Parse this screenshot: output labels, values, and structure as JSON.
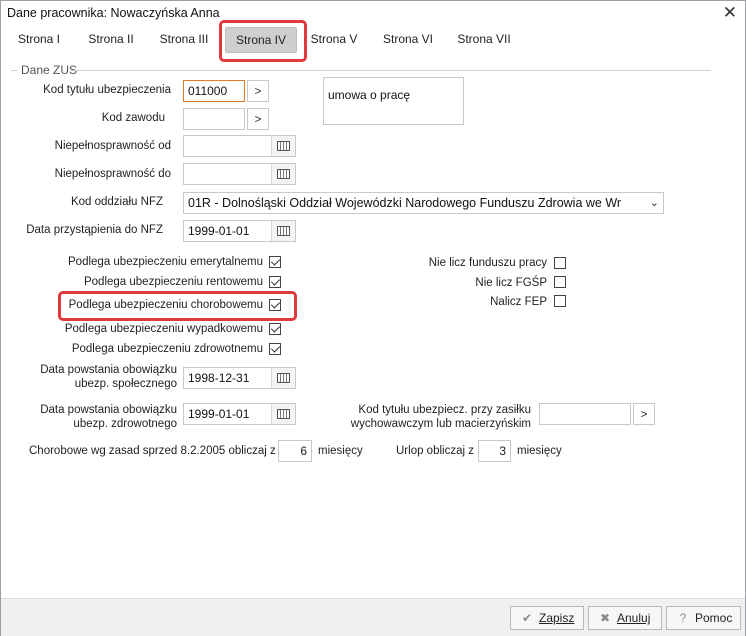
{
  "window": {
    "title": "Dane pracownika: Nowaczyńska Anna",
    "close": "✕"
  },
  "tabs": [
    {
      "label": "Strona I"
    },
    {
      "label": "Strona II"
    },
    {
      "label": "Strona III"
    },
    {
      "label": "Strona IV",
      "active": true
    },
    {
      "label": "Strona V"
    },
    {
      "label": "Strona VI"
    },
    {
      "label": "Strona VII"
    }
  ],
  "group": {
    "title": "Dane ZUS"
  },
  "fields": {
    "kod_tytulu_label": "Kod tytułu ubezpieczenia",
    "kod_tytulu_value": "011000",
    "kod_tytulu_desc": "umowa o pracę",
    "kod_zawodu_label": "Kod zawodu",
    "kod_zawodu_value": "",
    "niepelno_od_label": "Niepełnosprawność od",
    "niepelno_od_value": "",
    "niepelno_do_label": "Niepełnosprawność do",
    "niepelno_do_value": "",
    "kod_nfz_label": "Kod oddziału NFZ",
    "kod_nfz_value": "01R - Dolnośląski Oddział Wojewódzki Narodowego Funduszu Zdrowia we Wr",
    "data_nfz_label": "Data przystąpienia do NFZ",
    "data_nfz_value": "1999-01-01",
    "data_spol_label": "Data powstania obowiązku ubezp. społecznego",
    "data_spol_value": "1998-12-31",
    "data_zdrow_label": "Data powstania obowiązku ubezp. zdrowotnego",
    "data_zdrow_value": "1999-01-01",
    "kod_zasilku_label": "Kod tytułu ubezpiecz. przy zasiłku wychowawczym lub macierzyńskim",
    "kod_zasilku_value": ""
  },
  "checkboxes_left": [
    {
      "label": "Podlega ubezpieczeniu emerytalnemu",
      "checked": true
    },
    {
      "label": "Podlega ubezpieczeniu rentowemu",
      "checked": true
    },
    {
      "label": "Podlega ubezpieczeniu chorobowemu",
      "checked": true
    },
    {
      "label": "Podlega ubezpieczeniu wypadkowemu",
      "checked": true
    },
    {
      "label": "Podlega ubezpieczeniu zdrowotnemu",
      "checked": true
    }
  ],
  "checkboxes_right": [
    {
      "label": "Nie licz funduszu pracy",
      "checked": false
    },
    {
      "label": "Nie licz FGŚP",
      "checked": false
    },
    {
      "label": "Nalicz FEP",
      "checked": false
    }
  ],
  "bottom": {
    "chorobowe_label": "Chorobowe wg zasad sprzed 8.2.2005 obliczaj z",
    "chorobowe_value": "6",
    "chorobowe_unit": "miesięcy",
    "urlop_label": "Urlop obliczaj z",
    "urlop_value": "3",
    "urlop_unit": "miesięcy"
  },
  "footer": {
    "zapisz": "Zapisz",
    "anuluj": "Anuluj",
    "pomoc": "Pomoc"
  },
  "colors": {
    "highlight": "#e0393e",
    "active_tab_bg": "#cfcfcf",
    "focus_border": "#e07b2c"
  }
}
